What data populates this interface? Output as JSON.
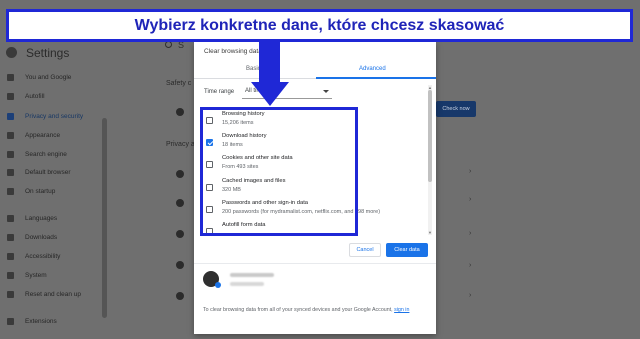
{
  "banner": {
    "text": "Wybierz konkretne dane, które chcesz skasować"
  },
  "settings": {
    "title": "Settings",
    "search_prefix": "S",
    "sidebar": [
      {
        "label": "You and Google",
        "icon": "person-icon"
      },
      {
        "label": "Autofill",
        "icon": "autofill-icon"
      },
      {
        "label": "Privacy and security",
        "icon": "shield-icon",
        "active": true
      },
      {
        "label": "Appearance",
        "icon": "palette-icon"
      },
      {
        "label": "Search engine",
        "icon": "search-icon"
      },
      {
        "label": "Default browser",
        "icon": "browser-icon"
      },
      {
        "label": "On startup",
        "icon": "power-icon"
      },
      {
        "label": "Languages",
        "icon": "globe-icon"
      },
      {
        "label": "Downloads",
        "icon": "download-icon"
      },
      {
        "label": "Accessibility",
        "icon": "accessibility-icon"
      },
      {
        "label": "System",
        "icon": "wrench-icon"
      },
      {
        "label": "Reset and clean up",
        "icon": "reset-icon"
      },
      {
        "label": "Extensions",
        "icon": "puzzle-icon"
      }
    ],
    "safety_label": "Safety c",
    "privacy_label": "Privacy a",
    "check_now": "Check now"
  },
  "dialog": {
    "title": "Clear browsing data",
    "tabs": {
      "basic": "Basic",
      "advanced": "Advanced"
    },
    "time_range_label": "Time range",
    "time_range_value": "All tim",
    "items": [
      {
        "label": "Browsing history",
        "sub": "15,206 items",
        "checked": false
      },
      {
        "label": "Download history",
        "sub": "18 items",
        "checked": true
      },
      {
        "label": "Cookies and other site data",
        "sub": "From 493 sites",
        "checked": false
      },
      {
        "label": "Cached images and files",
        "sub": "320 MB",
        "checked": false
      },
      {
        "label": "Passwords and other sign-in data",
        "sub": "200 passwords (for mydramalist.com, netflix.com, and 198 more)",
        "checked": false
      },
      {
        "label": "Autofill form data",
        "sub": "",
        "checked": false
      }
    ],
    "cancel": "Cancel",
    "clear": "Clear data",
    "account_name": "Sync is paused",
    "account_email": "account@gmail.com",
    "footer": "To clear browsing data from all of your synced devices and your Google Account,",
    "footer_link": "sign in"
  },
  "colors": {
    "annotation_blue": "#1f28d6",
    "accent": "#1a73e8"
  }
}
